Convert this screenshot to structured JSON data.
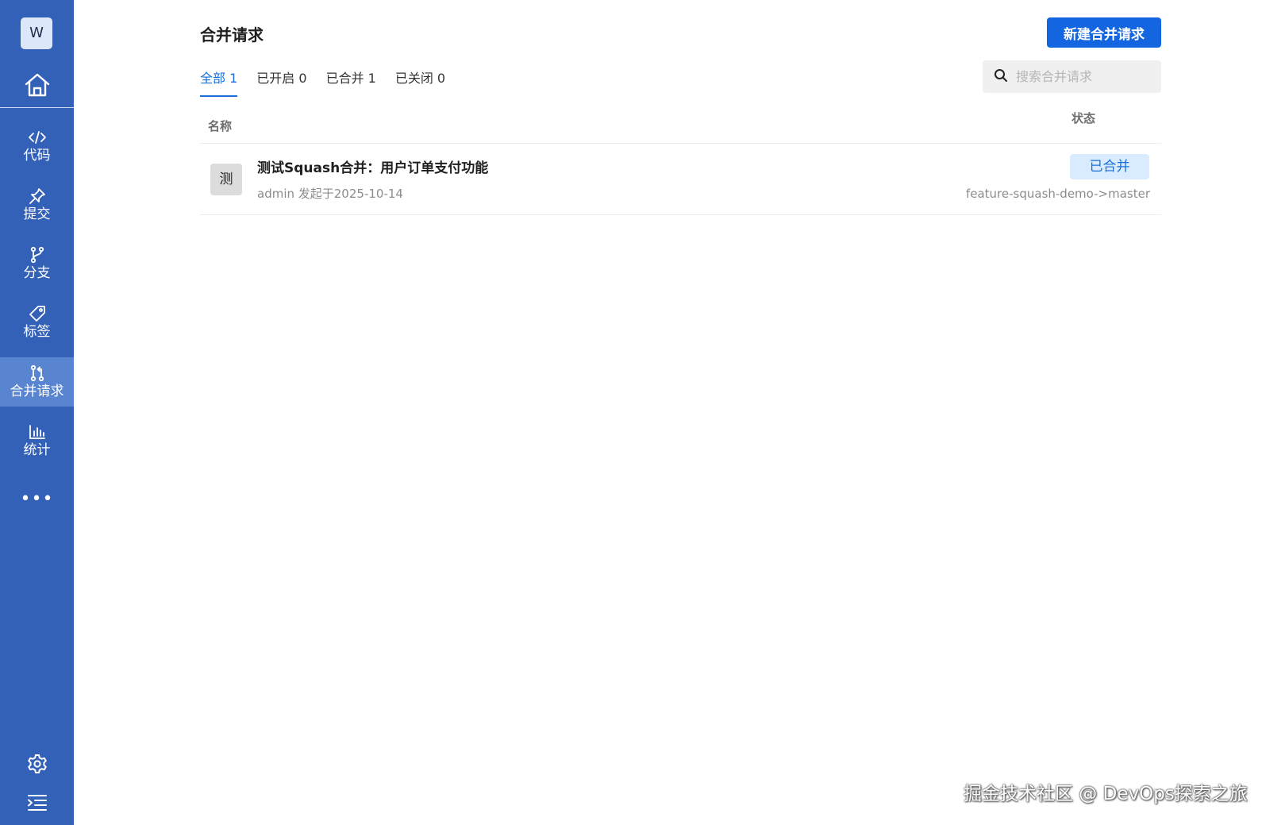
{
  "sidebar": {
    "avatar_letter": "W",
    "items": [
      {
        "label": "代码",
        "icon": "code-icon"
      },
      {
        "label": "提交",
        "icon": "pin-icon"
      },
      {
        "label": "分支",
        "icon": "branch-icon"
      },
      {
        "label": "标签",
        "icon": "tag-icon"
      },
      {
        "label": "合并请求",
        "icon": "merge-request-icon",
        "active": true
      },
      {
        "label": "统计",
        "icon": "bar-chart-icon"
      }
    ],
    "more_label": "•••"
  },
  "header": {
    "title": "合并请求",
    "new_button_label": "新建合并请求"
  },
  "tabs": [
    {
      "label": "全部 1",
      "active": true
    },
    {
      "label": "已开启 0"
    },
    {
      "label": "已合并 1"
    },
    {
      "label": "已关闭 0"
    }
  ],
  "search": {
    "placeholder": "搜索合并请求",
    "value": ""
  },
  "table": {
    "columns": {
      "name": "名称",
      "status": "状态"
    },
    "rows": [
      {
        "avatar_char": "测",
        "title": "测试Squash合并：用户订单支付功能",
        "meta": "admin 发起于2025-10-14",
        "status": "已合并",
        "branch": "feature-squash-demo->master"
      }
    ]
  },
  "watermark": "掘金技术社区 @ DevOps探索之旅",
  "colors": {
    "sidebar_bg": "#3361b7",
    "sidebar_active": "#5884d0",
    "primary": "#1366e0",
    "tab_active": "#1a6fd8",
    "status_bg": "#d9ebff"
  }
}
